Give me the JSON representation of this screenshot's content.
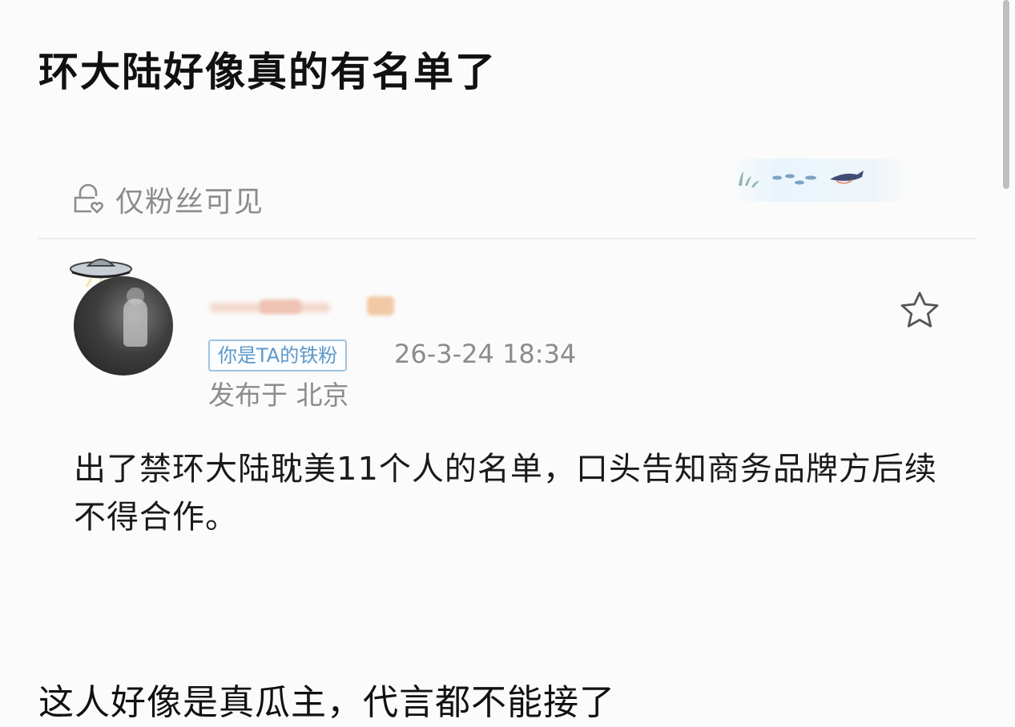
{
  "title": "环大陆好像真的有名单了",
  "visibility": {
    "icon": "lock-heart-icon",
    "label": "仅粉丝可见"
  },
  "post": {
    "badge": "你是TA的铁粉",
    "time": "26-3-24 18:34",
    "location": "发布于 北京",
    "text": "出了禁环大陆耽美11个人的名单，口头告知商务品牌方后续不得合作。",
    "favorite_icon": "star-outline-icon",
    "avatar_decoration_icon": "ufo-icon"
  },
  "comment": "这人好像是真瓜主，代言都不能接了",
  "colors": {
    "badge_border": "#9ec3e0",
    "badge_text": "#5d98c9",
    "muted_text": "#8c8c8c"
  }
}
